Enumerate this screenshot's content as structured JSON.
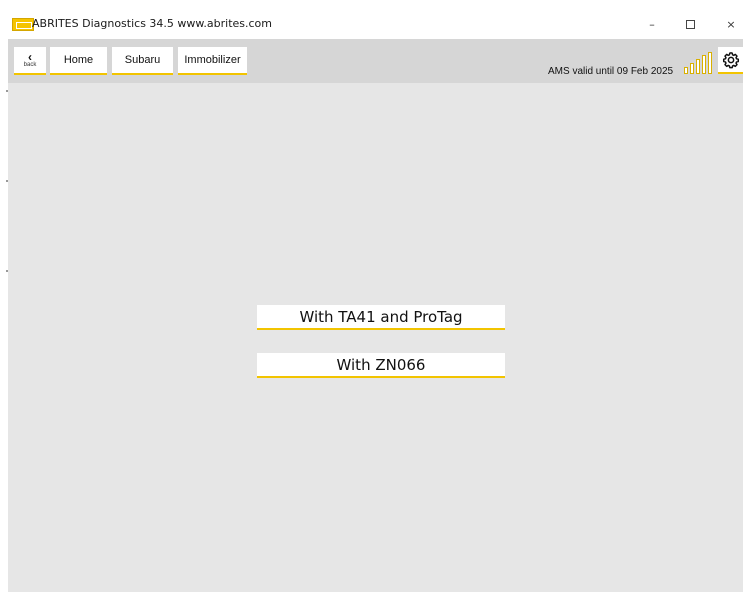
{
  "window": {
    "title": "ABRITES Diagnostics 34.5   www.abrites.com",
    "controls": {
      "minimize": "–",
      "close": "×"
    }
  },
  "toolbar": {
    "back_label": "back",
    "breadcrumbs": [
      "Home",
      "Subaru",
      "Immobilizer"
    ],
    "ams_status": "AMS valid until 09 Feb 2025",
    "signal_icon": "signal-strength-icon",
    "settings_icon": "gear-icon"
  },
  "main": {
    "options": [
      "With TA41 and ProTag",
      "With ZN066"
    ]
  },
  "colors": {
    "accent": "#f2c400",
    "background": "#e6e6e6",
    "toolbar": "#d6d6d6"
  }
}
